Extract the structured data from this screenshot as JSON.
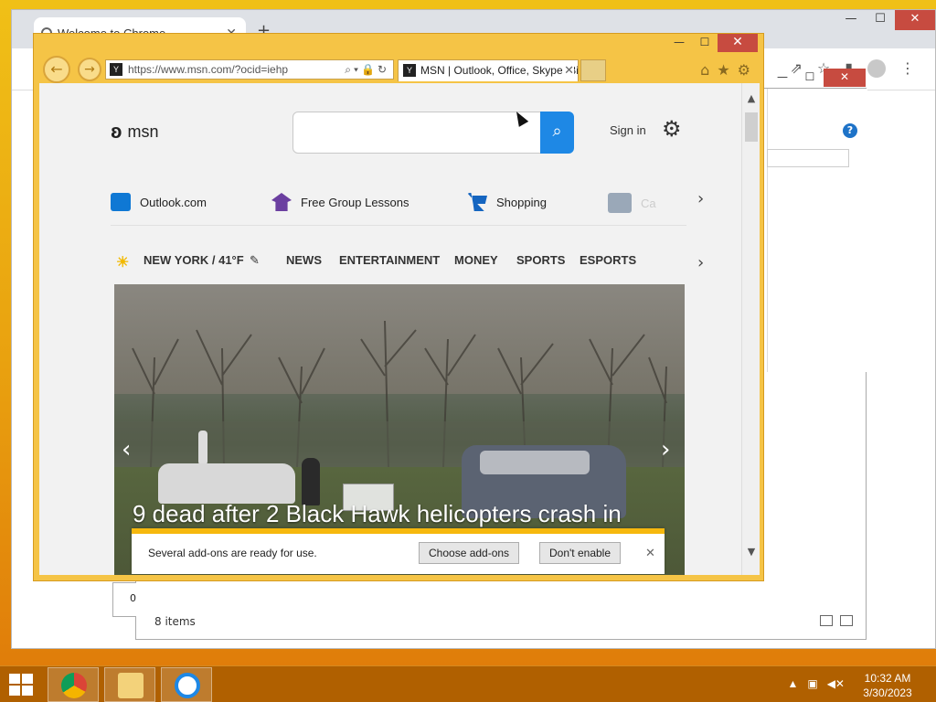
{
  "chrome": {
    "tab_title": "Welcome to Chrome",
    "new_tab": "+",
    "close": "✕",
    "minimize": "—",
    "maximize": "☐"
  },
  "explorer": {
    "status": "8 items",
    "stub_text": "0"
  },
  "ie": {
    "window_controls": {
      "minimize": "—",
      "maximize": "☐",
      "close": "✕"
    },
    "address_url": "https://www.msn.com/?ocid=iehp",
    "tab_title": "MSN | Outlook, Office, Skype, Bing, Breaking News, and Latest Videos"
  },
  "msn": {
    "logo_text": "msn",
    "search_placeholder": "",
    "sign_in": "Sign in",
    "quick_links": [
      {
        "label": "Outlook.com",
        "color": "#0f78d4"
      },
      {
        "label": "Free Group Lessons",
        "color": "#6b3fa0"
      },
      {
        "label": "Shopping",
        "color": "#1565c0"
      },
      {
        "label": "Ca",
        "color": "#9aa8b8"
      }
    ],
    "weather": "NEW YORK / 41°F",
    "nav": [
      "NEWS",
      "ENTERTAINMENT",
      "MONEY",
      "SPORTS",
      "ESPORTS"
    ],
    "headline": "9 dead after 2 Black Hawk helicopters crash in"
  },
  "notification": {
    "message": "Several add-ons are ready for use.",
    "choose": "Choose add-ons",
    "dont": "Don't enable"
  },
  "taskbar": {
    "time": "10:32 AM",
    "date": "3/30/2023"
  },
  "colors": {
    "accent_orange": "#f6b80e",
    "msn_blue": "#1e88e5",
    "close_red": "#c74b40"
  }
}
